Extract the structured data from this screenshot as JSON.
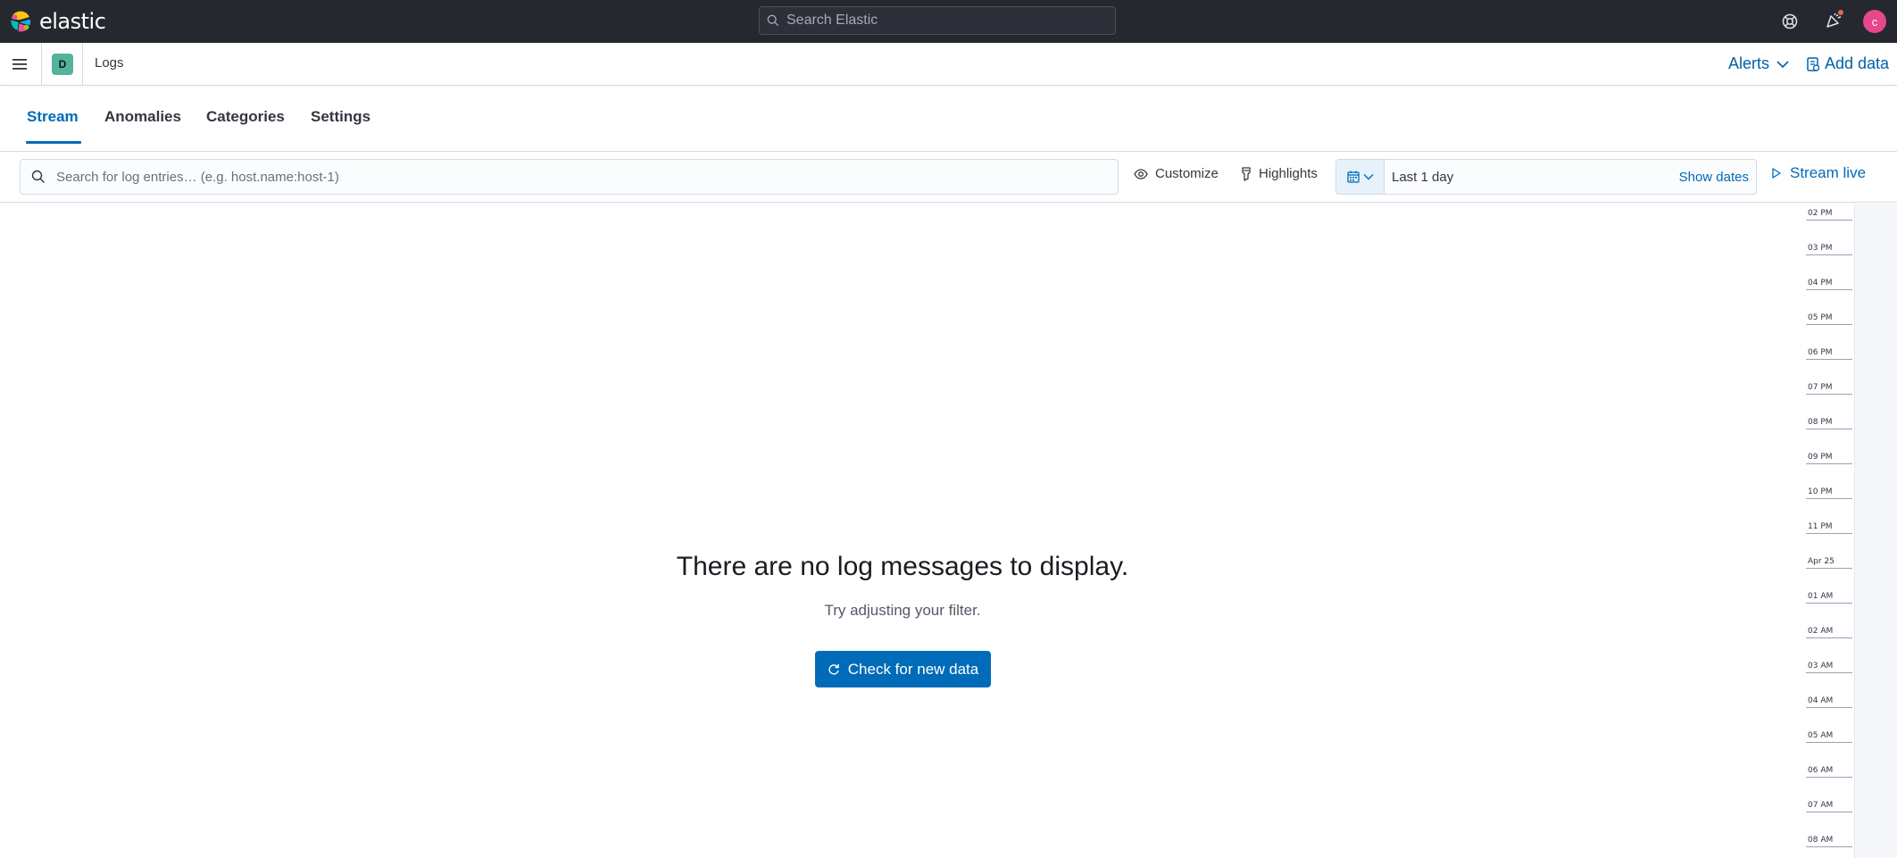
{
  "header": {
    "brand": "elastic",
    "search_placeholder": "Search Elastic",
    "user_initial": "c"
  },
  "subheader": {
    "space_initial": "D",
    "breadcrumb": "Logs",
    "alerts_label": "Alerts",
    "add_data_label": "Add data"
  },
  "tabs": [
    {
      "label": "Stream",
      "selected": true
    },
    {
      "label": "Anomalies",
      "selected": false
    },
    {
      "label": "Categories",
      "selected": false
    },
    {
      "label": "Settings",
      "selected": false
    }
  ],
  "toolbar": {
    "search_placeholder": "Search for log entries… (e.g. host.name:host-1)",
    "customize_label": "Customize",
    "highlights_label": "Highlights",
    "date_range": "Last 1 day",
    "show_dates_label": "Show dates",
    "stream_live_label": "Stream live"
  },
  "empty_state": {
    "title": "There are no log messages to display.",
    "body": "Try adjusting your filter.",
    "button_label": "Check for new data"
  },
  "time_ruler": [
    "02 PM",
    "03 PM",
    "04 PM",
    "05 PM",
    "06 PM",
    "07 PM",
    "08 PM",
    "09 PM",
    "10 PM",
    "11 PM",
    "Apr 25",
    "01 AM",
    "02 AM",
    "03 AM",
    "04 AM",
    "05 AM",
    "06 AM",
    "07 AM",
    "08 AM"
  ],
  "colors": {
    "header_bg": "#25282f",
    "accent": "#006bb8",
    "space_avatar": "#54b399",
    "user_avatar": "#e7478b",
    "notification_dot": "#e7664c"
  }
}
